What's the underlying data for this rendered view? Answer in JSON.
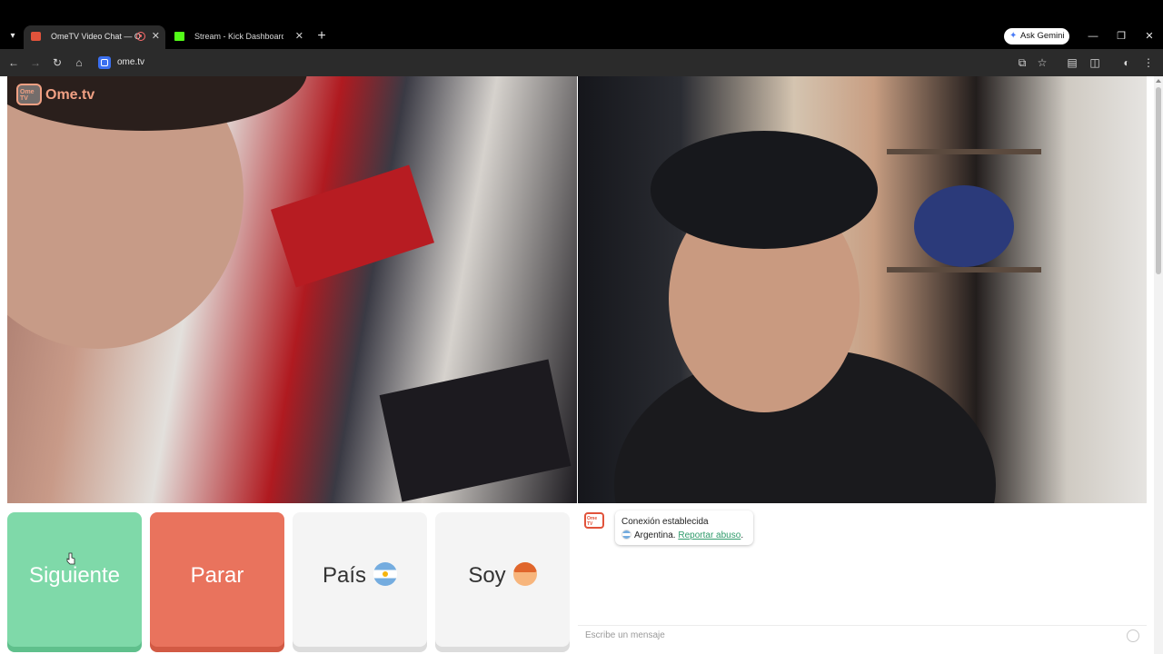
{
  "browser": {
    "tabs": [
      {
        "title": "OmeTV Video Chat — Omegle",
        "active": true
      },
      {
        "title": "Stream - Kick Dashboard",
        "active": false
      }
    ],
    "gemini_label": "Ask Gemini",
    "url": "ome.tv",
    "icons": {
      "tab_menu": "▾",
      "close": "✕",
      "new_tab": "+",
      "back": "←",
      "forward": "→",
      "reload": "↻",
      "home": "⌂",
      "minimize": "—",
      "restore": "❐",
      "window_close": "✕",
      "gemini_star": "✦",
      "cast": "⧉",
      "bookmark": "☆",
      "tab_search": "▤",
      "extensions": "◫",
      "profile": "◐",
      "menu": "⋮"
    }
  },
  "site": {
    "logo_small": "Ome TV",
    "logo_text": "Ome.tv",
    "controls": {
      "next_label": "Siguiente",
      "stop_label": "Parar",
      "country_label": "País",
      "gender_label": "Soy"
    },
    "chat": {
      "status": "Conexión establecida",
      "country": "Argentina.",
      "report_link": "Reportar abuso",
      "report_suffix": ".",
      "input_placeholder": "Escribe un mensaje"
    }
  },
  "colors": {
    "next_button": "#7fd9a9",
    "stop_button": "#e9735d",
    "link": "#2e9a6a",
    "brand": "#e1533b"
  }
}
